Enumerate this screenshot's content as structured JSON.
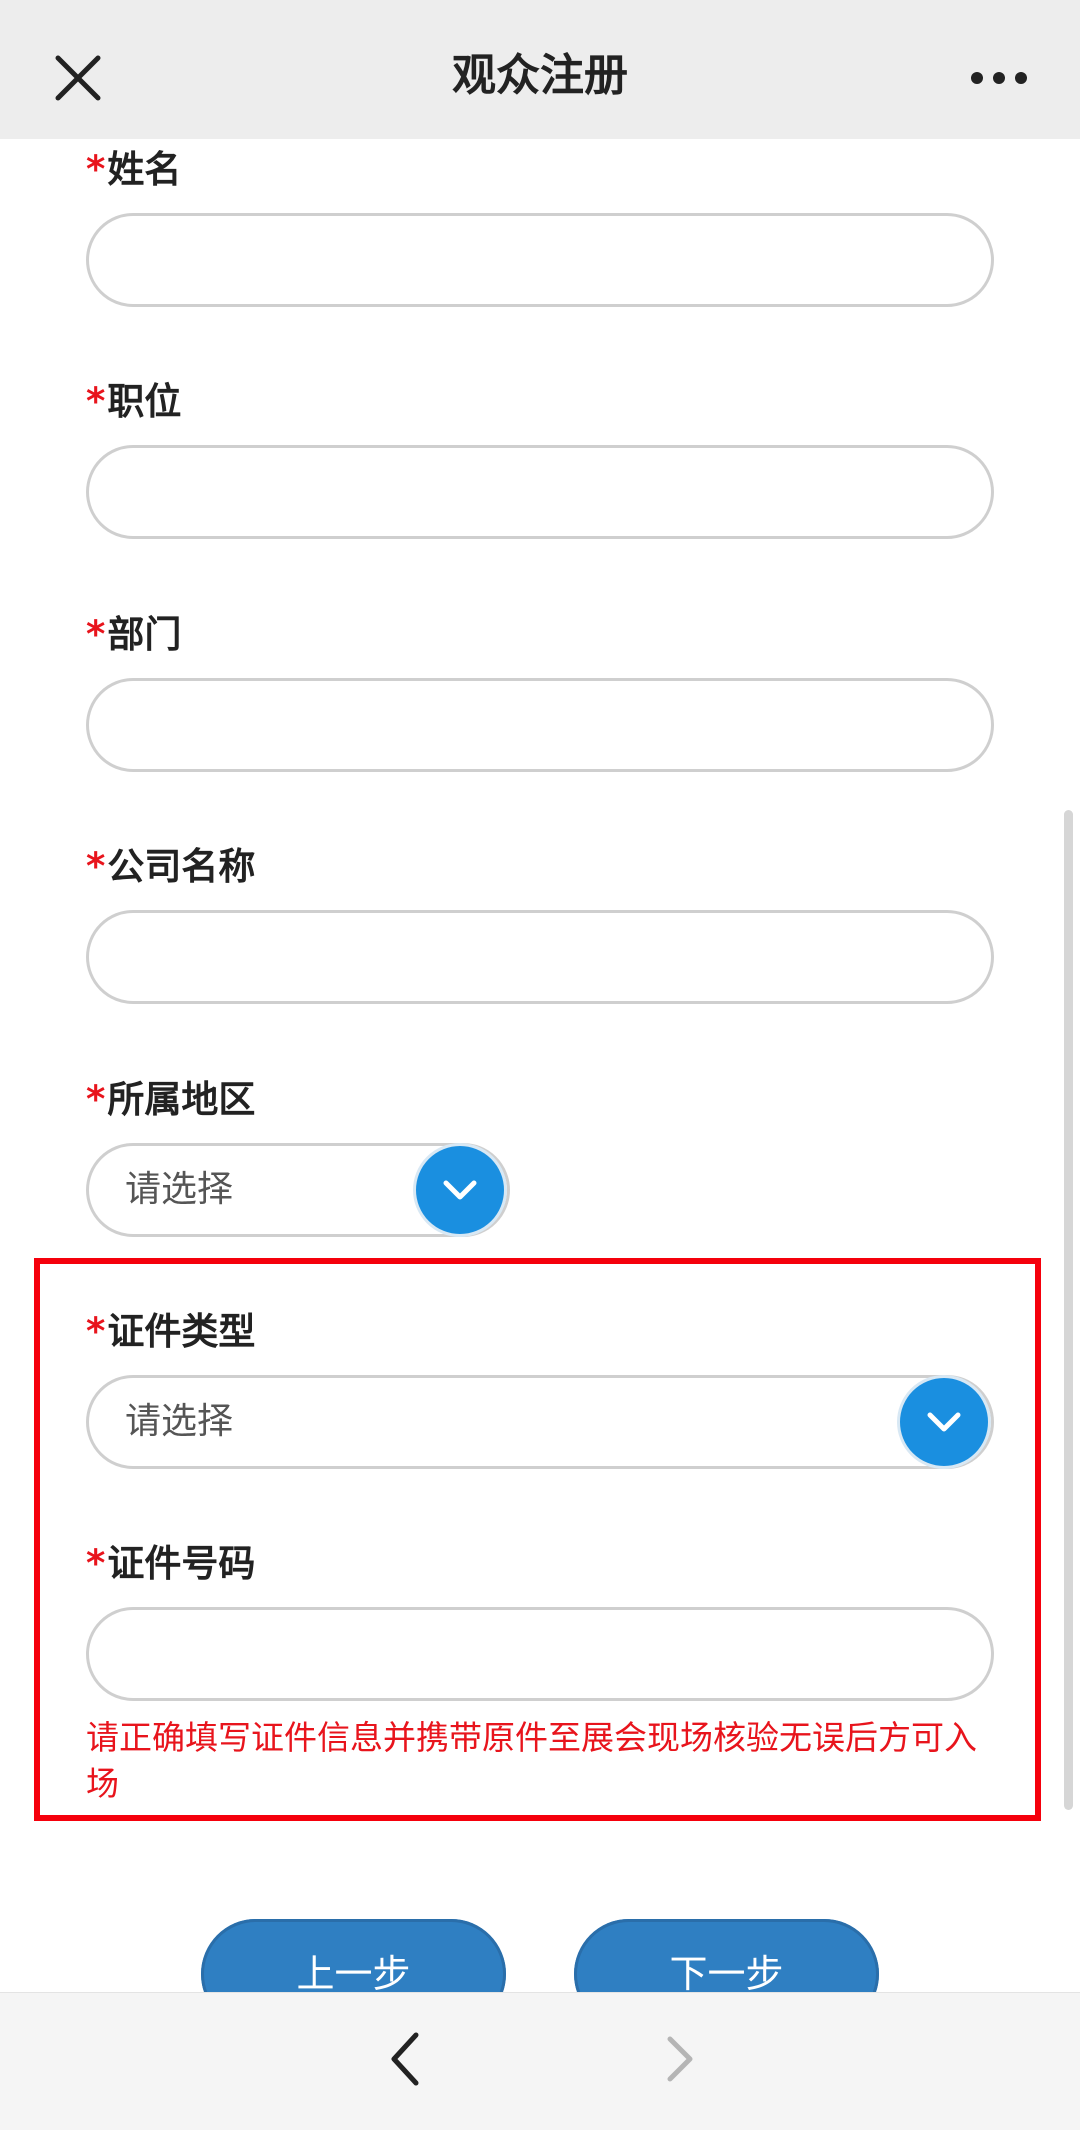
{
  "header": {
    "title": "观众注册",
    "close_icon": "close-icon",
    "more_icon": "more-icon"
  },
  "form": {
    "required_mark": "*",
    "fields": [
      {
        "label": "姓名",
        "type": "text",
        "value": ""
      },
      {
        "label": "职位",
        "type": "text",
        "value": ""
      },
      {
        "label": "部门",
        "type": "text",
        "value": ""
      },
      {
        "label": "公司名称",
        "type": "text",
        "value": ""
      },
      {
        "label": "所属地区",
        "type": "select",
        "value": "请选择"
      },
      {
        "label": "证件类型",
        "type": "select",
        "value": "请选择"
      },
      {
        "label": "证件号码",
        "type": "text",
        "value": ""
      }
    ],
    "id_notice": "请正确填写证件信息并携带原件至展会现场核验无误后方可入场"
  },
  "buttons": {
    "prev_label": "上一步",
    "next_label": "下一步"
  },
  "bottom_nav": {
    "back_icon": "chevron-left-icon",
    "forward_icon": "chevron-right-icon"
  },
  "colors": {
    "required": "#e8141c",
    "highlight_border": "#f5000c",
    "select_arrow_bg": "#1a8fe0",
    "button_bg": "#2f7fc2",
    "topbar_bg": "#ededed"
  }
}
